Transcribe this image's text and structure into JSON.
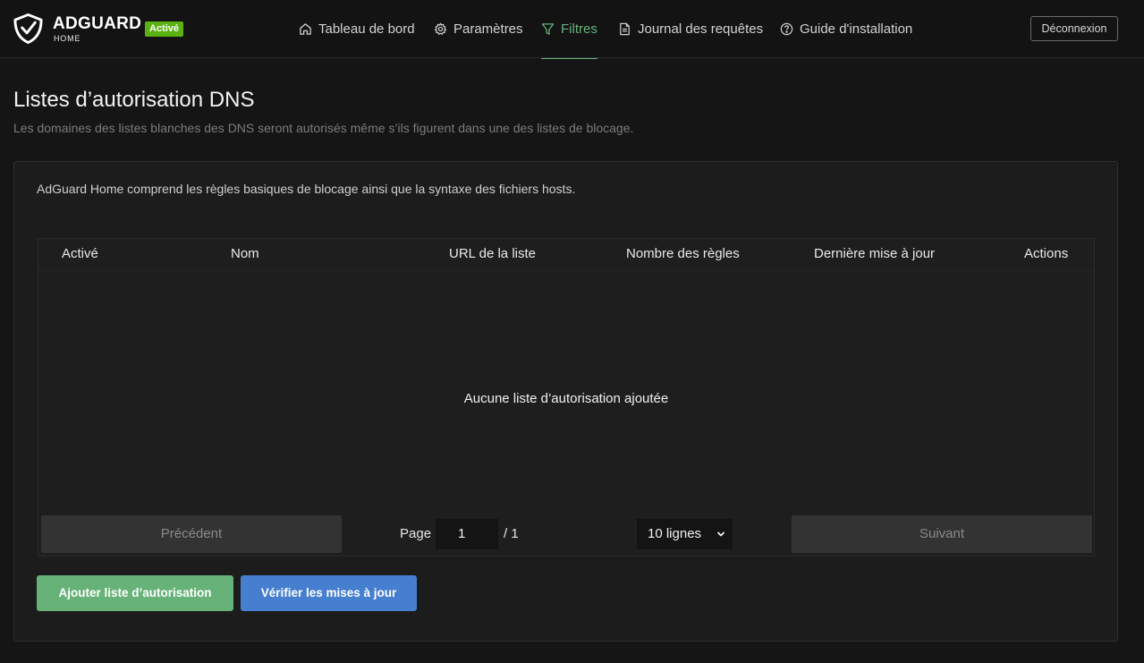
{
  "header": {
    "brand": "ADGUARD",
    "brand_sub": "HOME",
    "status": "Activé",
    "nav": [
      {
        "label": "Tableau de bord",
        "icon": "home-icon",
        "active": false
      },
      {
        "label": "Paramètres",
        "icon": "gear-icon",
        "active": false
      },
      {
        "label": "Filtres",
        "icon": "filter-icon",
        "active": true
      },
      {
        "label": "Journal des requêtes",
        "icon": "document-icon",
        "active": false
      },
      {
        "label": "Guide d'installation",
        "icon": "help-circle-icon",
        "active": false
      }
    ],
    "logout": "Déconnexion"
  },
  "page": {
    "title": "Listes d’autorisation DNS",
    "subtitle": "Les domaines des listes blanches des DNS seront autorisés même s’ils figurent dans une des listes de blocage."
  },
  "card": {
    "intro": "AdGuard Home comprend les règles basiques de blocage ainsi que la syntaxe des fichiers hosts.",
    "columns": [
      "Activé",
      "Nom",
      "URL de la liste",
      "Nombre des règles",
      "Dernière mise à jour",
      "Actions"
    ],
    "empty": "Aucune liste d’autorisation ajoutée",
    "pagination": {
      "previous": "Précédent",
      "page_label": "Page",
      "page_value": "1",
      "page_total": "/ 1",
      "rows": "10 lignes",
      "next": "Suivant"
    },
    "buttons": {
      "add": "Ajouter liste d’autorisation",
      "check_updates": "Vérifier les mises à jour"
    }
  },
  "colors": {
    "accent_green": "#67b279",
    "accent_blue": "#467fcf",
    "badge_green": "#5bb112",
    "background": "#151515"
  }
}
